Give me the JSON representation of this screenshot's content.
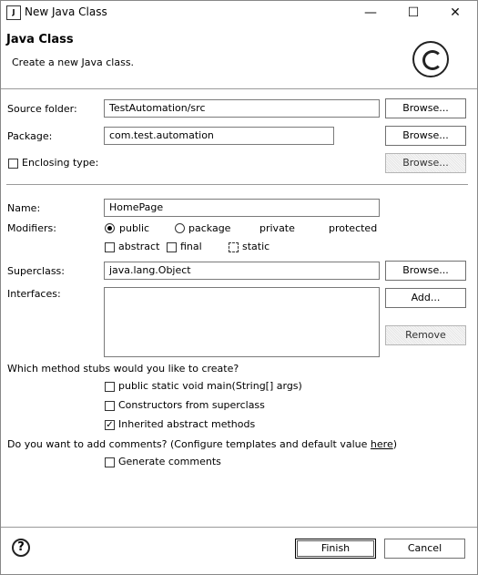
{
  "window": {
    "title": "New Java Class",
    "minimize_glyph": "—",
    "maximize_glyph": "☐",
    "close_glyph": "✕"
  },
  "header": {
    "title": "Java Class",
    "subtitle": "Create a new Java class."
  },
  "form": {
    "source_folder": {
      "label": "Source folder:",
      "value": "TestAutomation/src",
      "button": "Browse..."
    },
    "package": {
      "label": "Package:",
      "value": "com.test.automation",
      "button": "Browse..."
    },
    "enclosing": {
      "label": "Enclosing type:",
      "checked": false,
      "button": "Browse..."
    },
    "name": {
      "label": "Name:",
      "value": "HomePage"
    },
    "modifiers": {
      "label": "Modifiers:",
      "access": [
        {
          "label": "public",
          "selected": true
        },
        {
          "label": "package",
          "selected": false
        },
        {
          "label": "private",
          "selected": false
        },
        {
          "label": "protected",
          "selected": false
        }
      ],
      "abstract": "abstract",
      "final": "final",
      "static": "static"
    },
    "superclass": {
      "label": "Superclass:",
      "value": "java.lang.Object",
      "button": "Browse..."
    },
    "interfaces": {
      "label": "Interfaces:",
      "add_button": "Add...",
      "remove_button": "Remove"
    }
  },
  "stubs": {
    "question": "Which method stubs would you like to create?",
    "main": {
      "label": "public static void main(String[] args)",
      "checked": false
    },
    "constructors": {
      "label": "Constructors from superclass",
      "checked": false
    },
    "inherited": {
      "label": "Inherited abstract methods",
      "checked": true
    }
  },
  "comments": {
    "question": "Do you want to add comments? (Configure templates and default value ",
    "link": "here",
    "close_paren": ")",
    "generate": {
      "label": "Generate comments",
      "checked": false
    }
  },
  "footer": {
    "help": "?",
    "finish": "Finish",
    "cancel": "Cancel"
  },
  "checkmark": "✓"
}
